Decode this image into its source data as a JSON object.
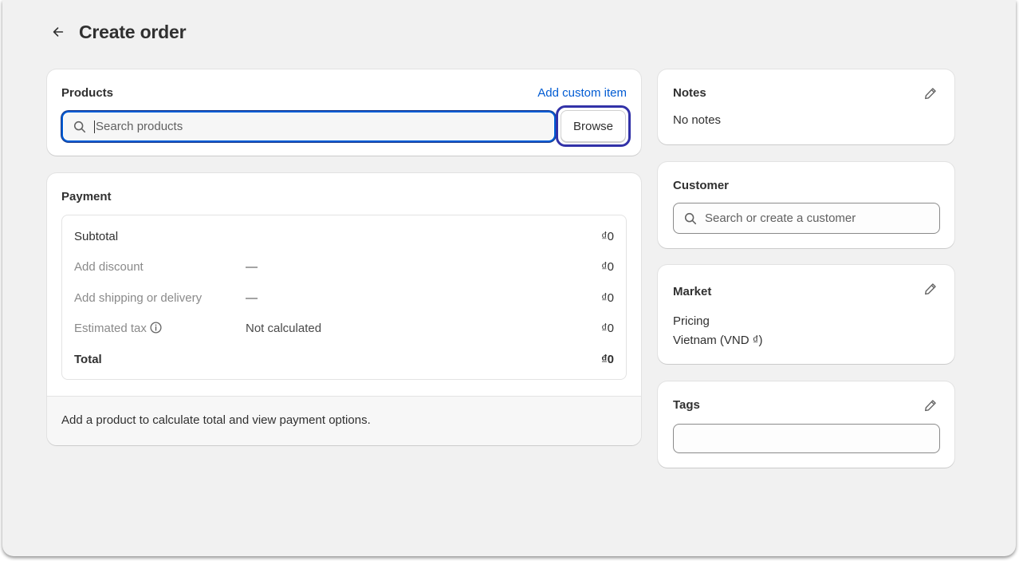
{
  "header": {
    "title": "Create order",
    "back_icon": "arrow-left-icon"
  },
  "products": {
    "title": "Products",
    "add_custom_label": "Add custom item",
    "search_placeholder": "Search products",
    "browse_label": "Browse"
  },
  "payment": {
    "title": "Payment",
    "rows": [
      {
        "label": "Subtotal",
        "middle": "",
        "amount": "₫0",
        "muted": false
      },
      {
        "label": "Add discount",
        "middle": "—",
        "amount": "₫0",
        "muted": true
      },
      {
        "label": "Add shipping or delivery",
        "middle": "—",
        "amount": "₫0",
        "muted": true
      },
      {
        "label": "Estimated tax",
        "middle": "Not calculated",
        "amount": "₫0",
        "muted": true
      },
      {
        "label": "Total",
        "middle": "",
        "amount": "₫0",
        "muted": false
      }
    ],
    "footer": "Add a product to calculate total and view payment options."
  },
  "notes": {
    "title": "Notes",
    "text": "No notes"
  },
  "customer": {
    "title": "Customer",
    "search_placeholder": "Search or create a customer"
  },
  "market": {
    "title": "Market",
    "pricing_label": "Pricing",
    "pricing_value": "Vietnam (VND ₫)"
  },
  "tags": {
    "title": "Tags",
    "value": ""
  },
  "colors": {
    "accent": "#005bd3",
    "focus_ring": "#3232a8",
    "background": "#f1f1f1"
  }
}
